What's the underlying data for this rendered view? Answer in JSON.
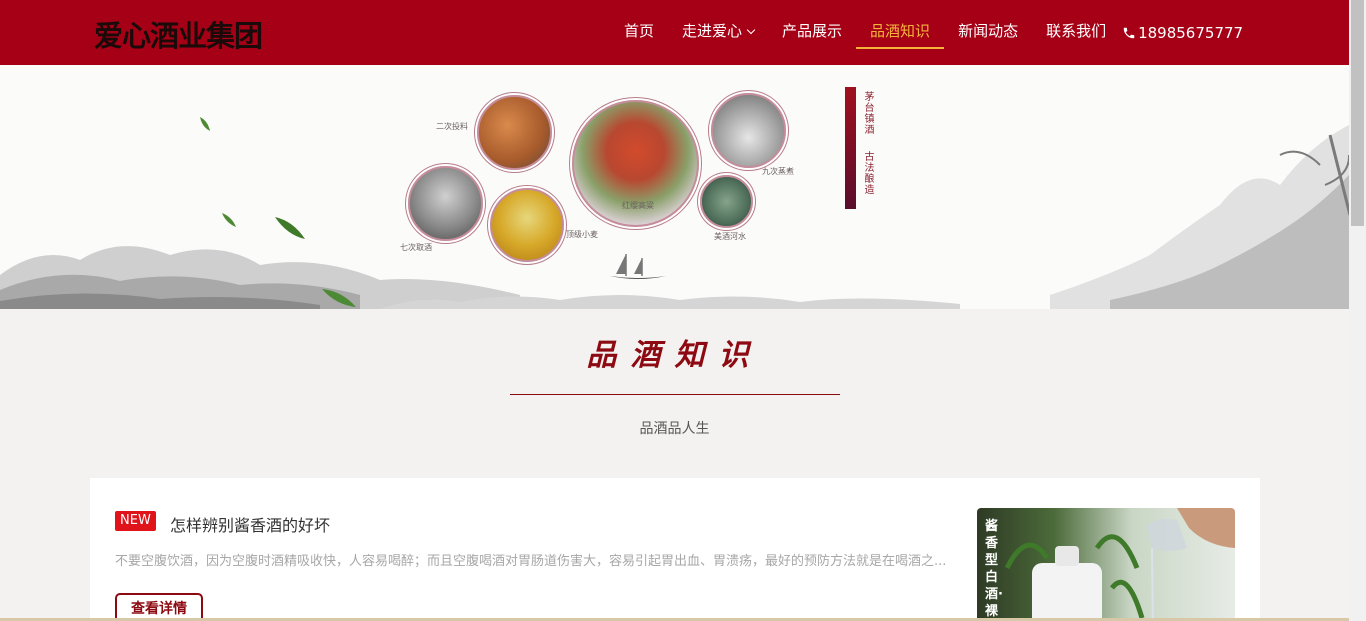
{
  "header": {
    "logo": "爱心酒业集团",
    "nav": [
      {
        "label": "首页"
      },
      {
        "label": "走进爱心",
        "has_dropdown": true
      },
      {
        "label": "产品展示"
      },
      {
        "label": "品酒知识",
        "active": true
      },
      {
        "label": "新闻动态"
      },
      {
        "label": "联系我们"
      }
    ],
    "phone": "18985675777",
    "bg_color": "#a50016",
    "active_color": "#f6b33c"
  },
  "banner": {
    "captions": {
      "c1": "二次投料",
      "c2": "红缨高粱",
      "c3": "九次蒸煮",
      "c4": "七次取酒",
      "c5": "顶级小麦",
      "c6": "美酒河水"
    },
    "vertical_text_1": "茅台镇酒",
    "vertical_text_2": "古法酿造"
  },
  "section": {
    "title": "品酒知识",
    "subtitle": "品酒品人生"
  },
  "article": {
    "badge": "NEW",
    "title": "怎样辨别酱香酒的好坏",
    "desc": "不要空腹饮酒，因为空腹时酒精吸收快，人容易喝醉；而且空腹喝酒对胃肠道伤害大，容易引起胃出血、胃溃疡，最好的预防方法就是在喝酒之...",
    "button": "查看详情",
    "image_text": "酱香型白酒·裸"
  }
}
